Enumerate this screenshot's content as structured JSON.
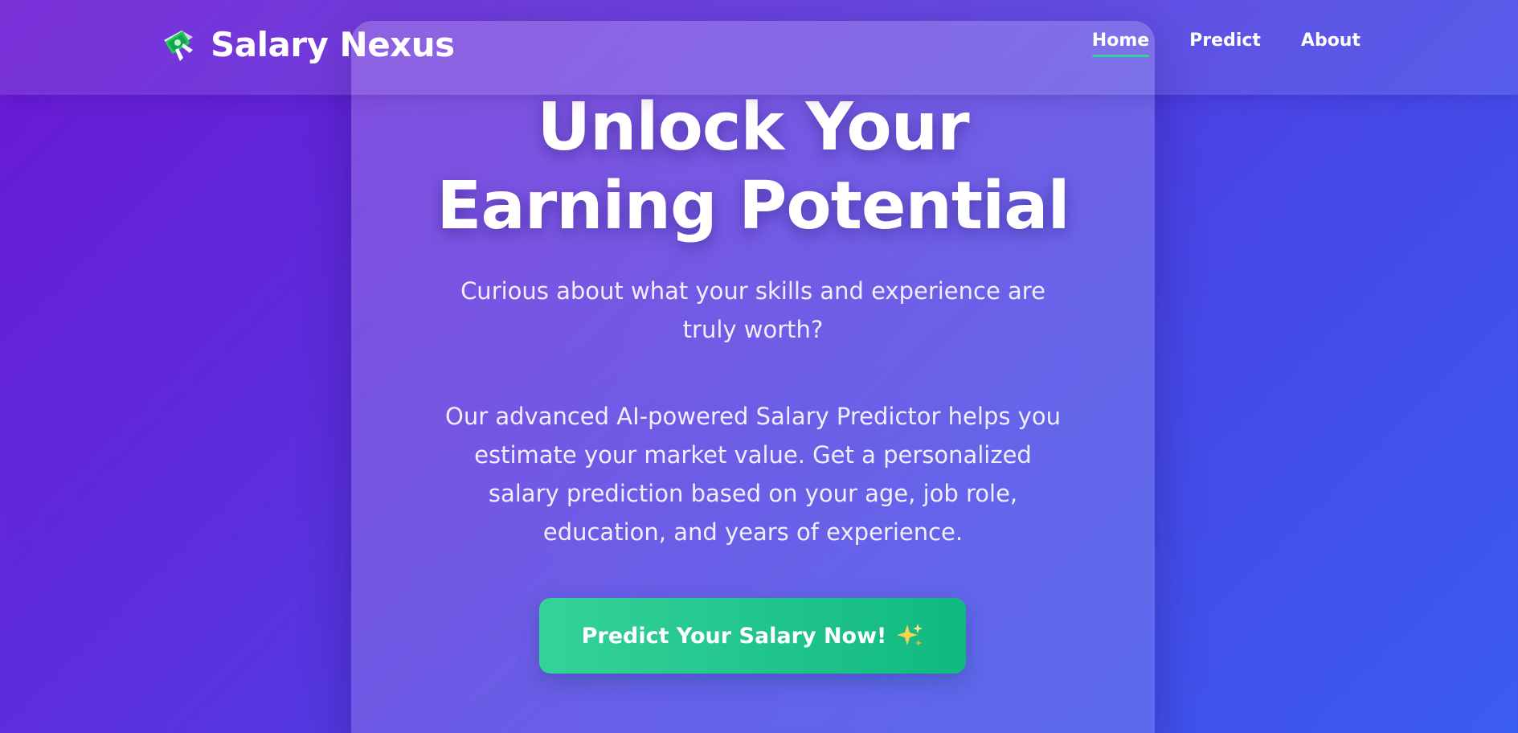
{
  "header": {
    "brand_icon": "money-with-wings-icon",
    "brand_title": "Salary Nexus",
    "nav": [
      {
        "label": "Home",
        "active": true
      },
      {
        "label": "Predict",
        "active": false
      },
      {
        "label": "About",
        "active": false
      }
    ],
    "accent_color": "#34d399"
  },
  "hero": {
    "title_line1": "Unlock Your",
    "title_line2": "Earning Potential",
    "subtitle": "Curious about what your skills and experience are truly worth?",
    "description": "Our advanced AI-powered Salary Predictor helps you estimate your market value. Get a personalized salary prediction based on your age, job role, education, and years of experience.",
    "cta_label": "Predict Your Salary Now!",
    "cta_icon": "sparkles-icon",
    "cta_colors": [
      "#34d399",
      "#10b981"
    ]
  },
  "background_colors": [
    "#6a19d3",
    "#3b5cf0"
  ]
}
